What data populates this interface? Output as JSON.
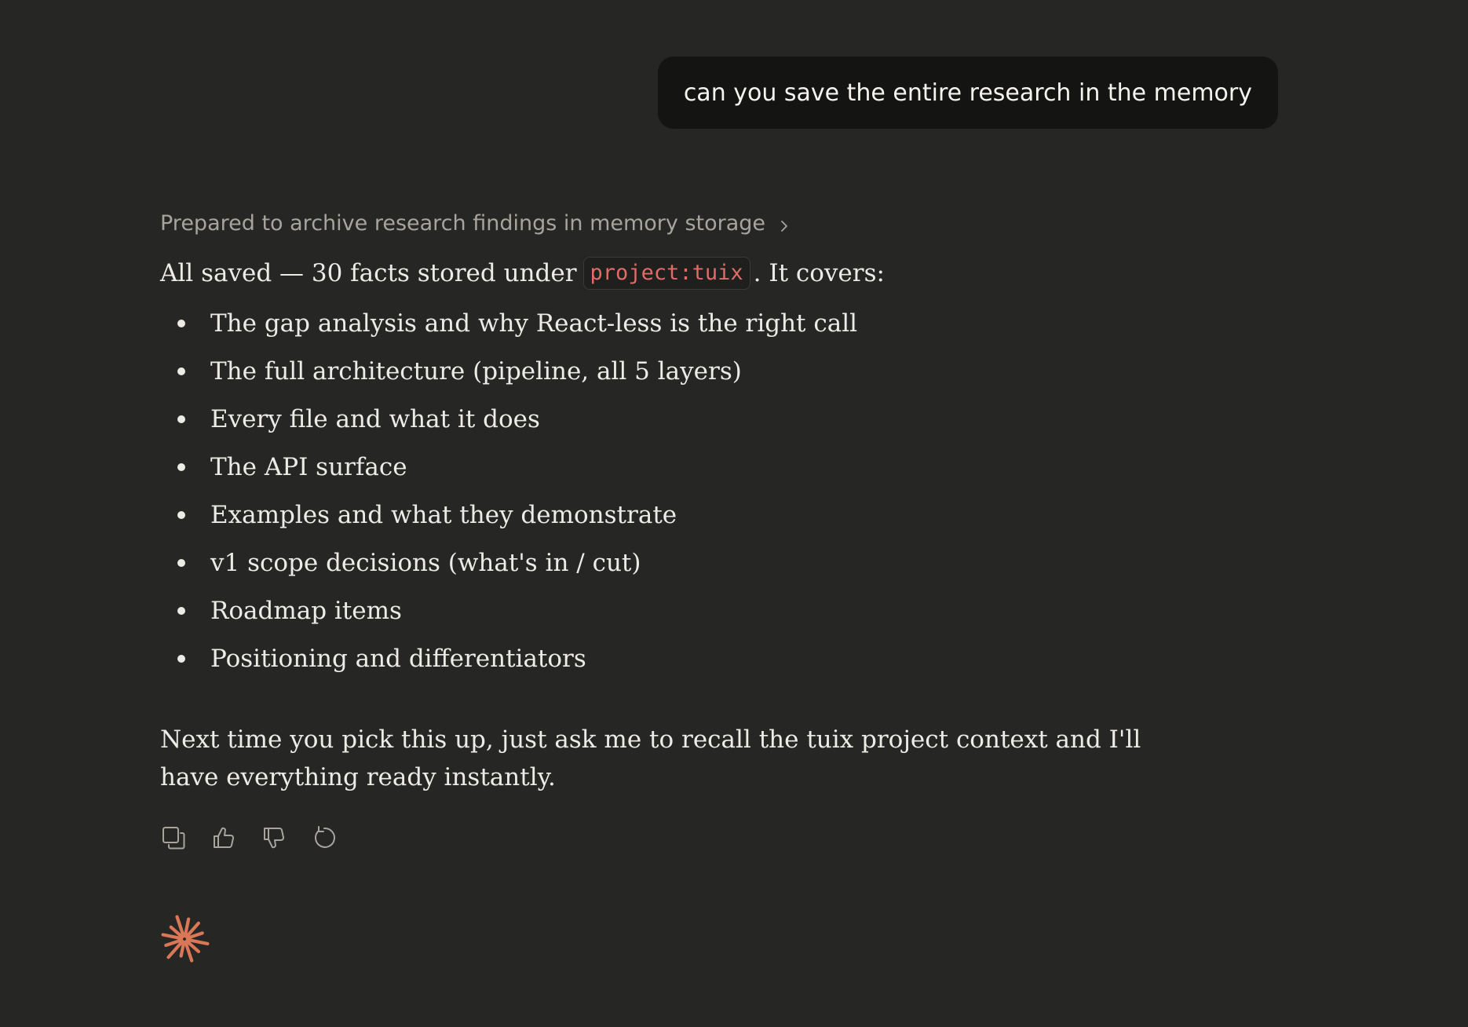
{
  "user_message": "can you save the entire research in the memory",
  "assistant": {
    "thinking_label": "Prepared to archive research findings in memory storage",
    "intro_prefix": "All saved — 30 facts stored under",
    "intro_code": "project:tuix",
    "intro_suffix": ". It covers:",
    "items": [
      "The gap analysis and why React-less is the right call",
      "The full architecture (pipeline, all 5 layers)",
      "Every file and what it does",
      "The API surface",
      "Examples and what they demonstrate",
      "v1 scope decisions (what's in / cut)",
      "Roadmap items",
      "Positioning and differentiators"
    ],
    "outro": "Next time you pick this up, just ask me to recall the tuix project context and I'll have everything ready instantly."
  },
  "actions": {
    "copy_icon": "copy-icon",
    "thumbs_up_icon": "thumbs-up-icon",
    "thumbs_down_icon": "thumbs-down-icon",
    "retry_icon": "retry-icon"
  },
  "colors": {
    "background": "#262624",
    "user_bubble": "#141413",
    "code_text": "#e06c68",
    "logo": "#d97757"
  }
}
